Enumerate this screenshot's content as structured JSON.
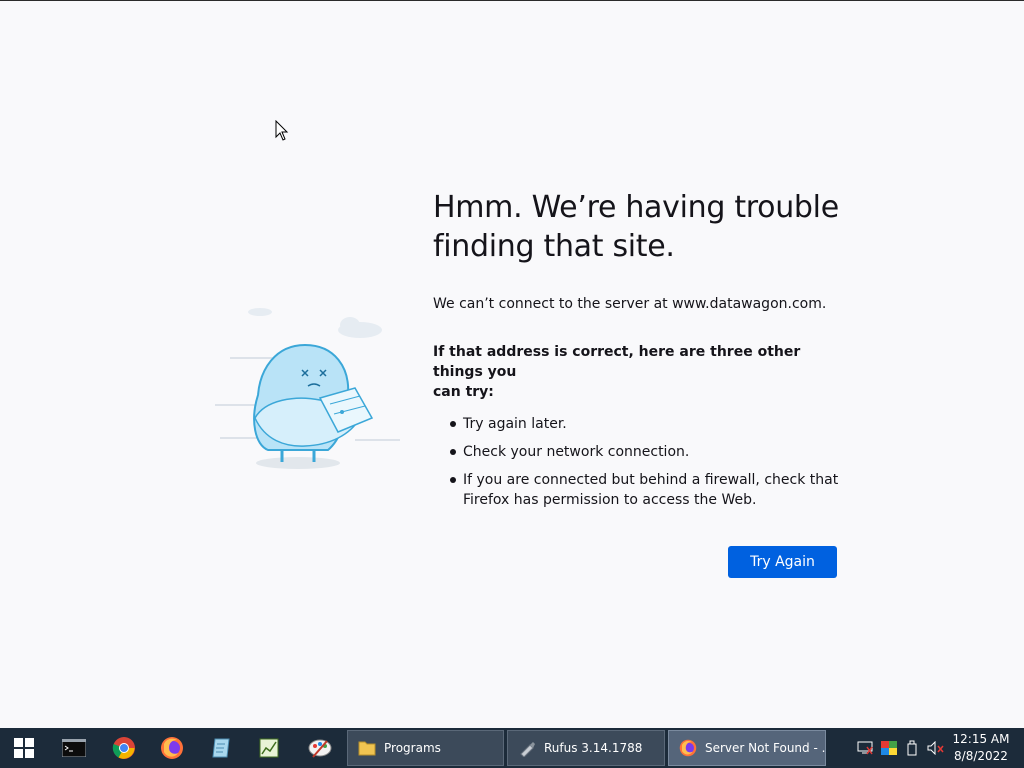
{
  "page": {
    "title_line1": "Hmm. We’re having trouble",
    "title_line2": "finding that site.",
    "description": "We can’t connect to the server at www.datawagon.com.",
    "suggestions_heading_line1": "If that address is correct, here are three other things you",
    "suggestions_heading_line2": "can try:",
    "suggestions": [
      "Try again later.",
      "Check your network connection.",
      "If you are connected but behind a firewall, check that",
      "Firefox has permission to access the Web."
    ],
    "try_again_label": "Try Again"
  },
  "taskbar": {
    "pinned_icons": [
      "windows-start-icon",
      "command-prompt-icon",
      "chrome-icon",
      "firefox-icon",
      "notepad-icon",
      "app-chart-icon",
      "paint-icon"
    ],
    "windows": [
      {
        "label": "Programs",
        "icon": "folder-icon"
      },
      {
        "label": "Rufus 3.14.1788",
        "icon": "usb-drive-icon"
      },
      {
        "label": "Server Not Found - ...",
        "icon": "firefox-icon"
      }
    ],
    "clock_time": "12:15 AM",
    "clock_date": "8/8/2022"
  },
  "colors": {
    "background": "#f9f9fb",
    "button": "#0061e0",
    "taskbar": "#1c2b3a"
  }
}
